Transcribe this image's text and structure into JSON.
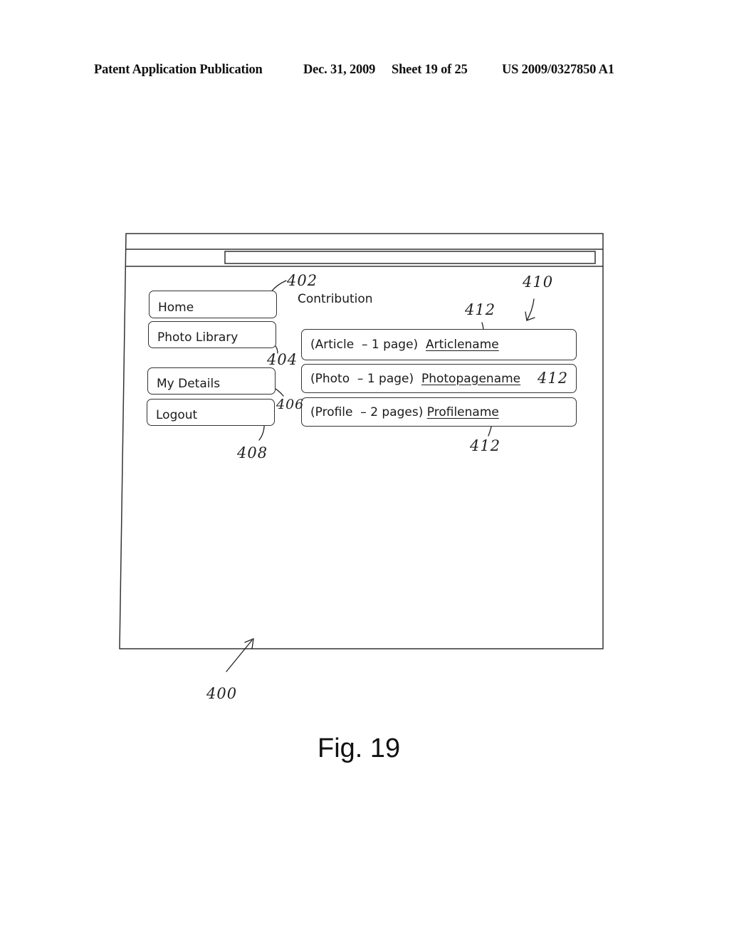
{
  "header": {
    "publication": "Patent Application Publication",
    "date": "Dec. 31, 2009",
    "sheet": "Sheet 19 of 25",
    "patent_number": "US 2009/0327850 A1"
  },
  "figure": {
    "caption": "Fig. 19",
    "window": {
      "address_bar_value": "",
      "nav_buttons": [
        {
          "label": "Home",
          "ref": "402"
        },
        {
          "label": "Photo Library",
          "ref": "404"
        },
        {
          "label": "My Details",
          "ref": "406"
        },
        {
          "label": "Logout",
          "ref": "408"
        }
      ],
      "contribution_heading": "Contribution",
      "contribution_list_ref": "410",
      "contributions": [
        {
          "type_info": "(Article  – 1 page)  ",
          "link": "Articlename",
          "ref": "412"
        },
        {
          "type_info": "(Photo  – 1 page)  ",
          "link": "Photopagename",
          "ref": "412"
        },
        {
          "type_info": "(Profile  – 2 pages) ",
          "link": "Profilename",
          "ref": "412"
        }
      ]
    },
    "window_ref": "400"
  }
}
